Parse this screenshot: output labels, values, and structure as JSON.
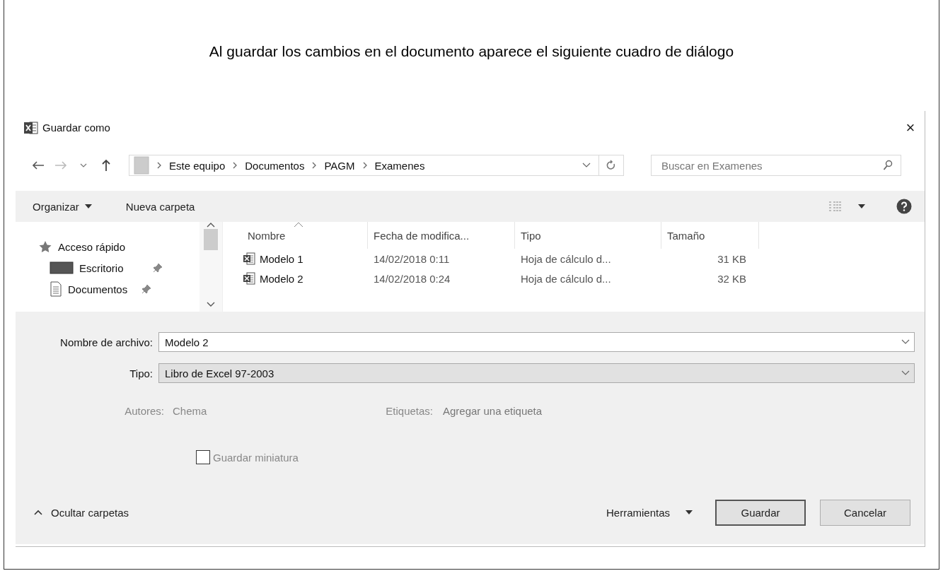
{
  "caption": "Al guardar los cambios en el documento aparece el siguiente cuadro de diálogo",
  "window": {
    "title": "Guardar como",
    "close": "×"
  },
  "address": {
    "crumbs": [
      "Este equipo",
      "Documentos",
      "PAGM",
      "Examenes"
    ]
  },
  "search": {
    "placeholder": "Buscar en Examenes"
  },
  "toolbar": {
    "organize": "Organizar",
    "new_folder": "Nueva carpeta"
  },
  "nav": {
    "items": [
      {
        "label": "Acceso rápido",
        "kind": "star",
        "pinned": false
      },
      {
        "label": "Escritorio",
        "kind": "desktop",
        "pinned": true
      },
      {
        "label": "Documentos",
        "kind": "document",
        "pinned": true
      }
    ]
  },
  "files": {
    "columns": [
      "Nombre",
      "Fecha de modifica...",
      "Tipo",
      "Tamaño"
    ],
    "rows": [
      {
        "name": "Modelo 1",
        "date": "14/02/2018 0:11",
        "type": "Hoja de cálculo d...",
        "size": "31 KB"
      },
      {
        "name": "Modelo 2",
        "date": "14/02/2018 0:24",
        "type": "Hoja de cálculo d...",
        "size": "32 KB"
      }
    ]
  },
  "form": {
    "filename_label": "Nombre de archivo:",
    "filename": "Modelo 2",
    "type_label": "Tipo:",
    "type": "Libro de Excel 97-2003",
    "authors_label": "Autores:",
    "authors": "Chema",
    "tags_label": "Etiquetas:",
    "tags": "Agregar una etiqueta",
    "thumbnail": {
      "label": "Guardar miniatura",
      "checked": false
    }
  },
  "footer": {
    "hide_folders": "Ocultar carpetas",
    "tools": "Herramientas",
    "save": "Guardar",
    "cancel": "Cancelar"
  }
}
